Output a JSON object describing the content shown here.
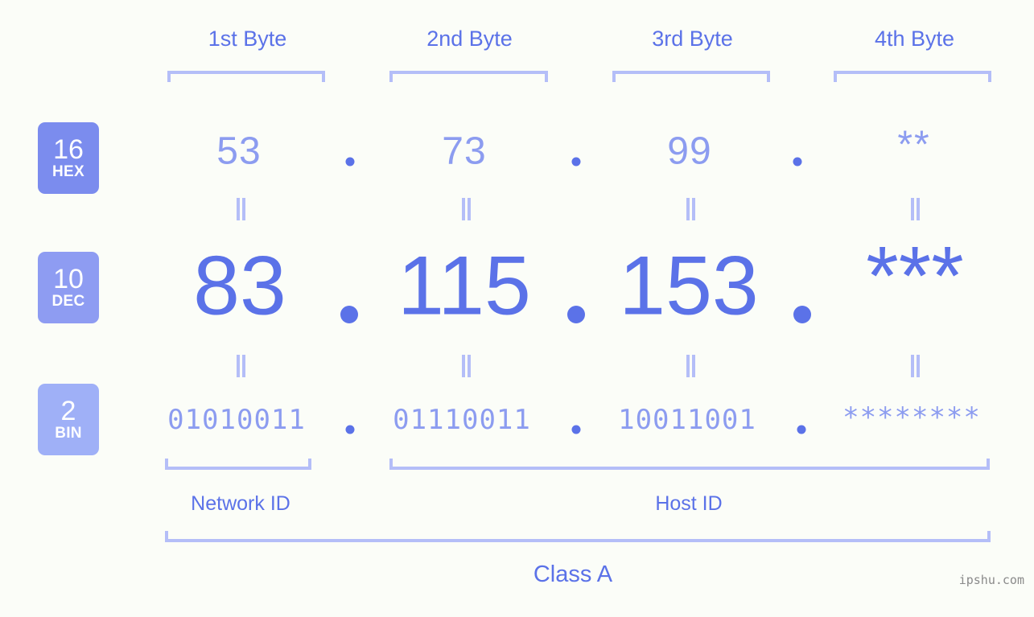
{
  "page": {
    "background": "#fbfdf8",
    "accent_dark": "#5b72e8",
    "accent_mid": "#8c9cf0",
    "accent_light": "#b4bef8",
    "watermark": "ipshu.com"
  },
  "byte_headers": [
    {
      "label": "1st Byte"
    },
    {
      "label": "2nd Byte"
    },
    {
      "label": "3rd Byte"
    },
    {
      "label": "4th Byte"
    }
  ],
  "bases": [
    {
      "number": "16",
      "name": "HEX",
      "color": "#7b8cee"
    },
    {
      "number": "10",
      "name": "DEC",
      "color": "#8e9cf2"
    },
    {
      "number": "2",
      "name": "BIN",
      "color": "#9fb0f7"
    }
  ],
  "rows": {
    "hex": {
      "values": [
        "53",
        "73",
        "99",
        "**"
      ],
      "separator": "."
    },
    "dec": {
      "values": [
        "83",
        "115",
        "153",
        "***"
      ],
      "separator": "."
    },
    "bin": {
      "values": [
        "01010011",
        "01110011",
        "10011001",
        "********"
      ],
      "separator": "."
    }
  },
  "equals_symbol": "=",
  "segments": [
    {
      "label": "Network ID"
    },
    {
      "label": "Host ID"
    }
  ],
  "ip_class": {
    "label": "Class A"
  }
}
